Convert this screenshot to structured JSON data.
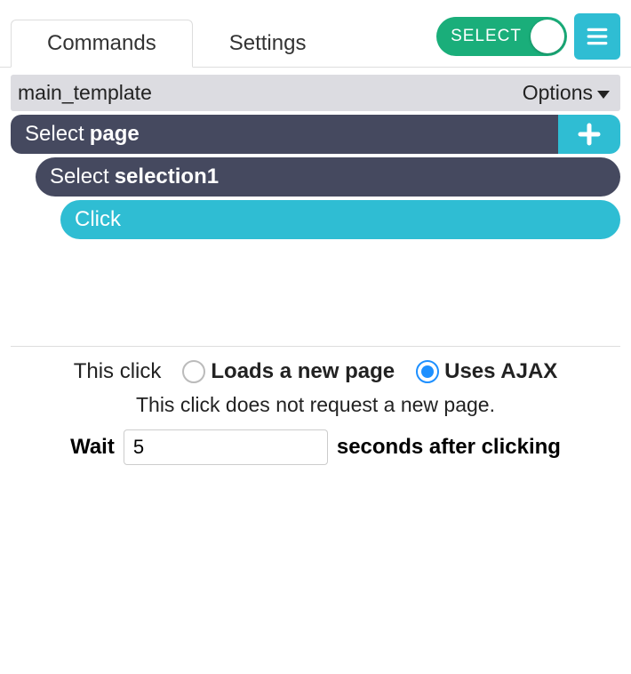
{
  "tabs": {
    "commands": "Commands",
    "settings": "Settings"
  },
  "toggle": {
    "label": "SELECT"
  },
  "template": {
    "name": "main_template",
    "options_label": "Options"
  },
  "commands": [
    {
      "prefix": "Select",
      "target": "page",
      "style": "dark",
      "indent": 0,
      "has_add": true
    },
    {
      "prefix": "Select",
      "target": "selection1",
      "style": "dark",
      "indent": 1,
      "has_add": false
    },
    {
      "prefix": "Click",
      "target": "",
      "style": "teal",
      "indent": 2,
      "has_add": false
    }
  ],
  "click_opts": {
    "label": "This click",
    "loads_label": "Loads a new page",
    "ajax_label": "Uses AJAX",
    "selected": "ajax",
    "note": "This click does not request a new page.",
    "wait_prefix": "Wait",
    "wait_value": "5",
    "wait_suffix": "seconds after clicking"
  }
}
